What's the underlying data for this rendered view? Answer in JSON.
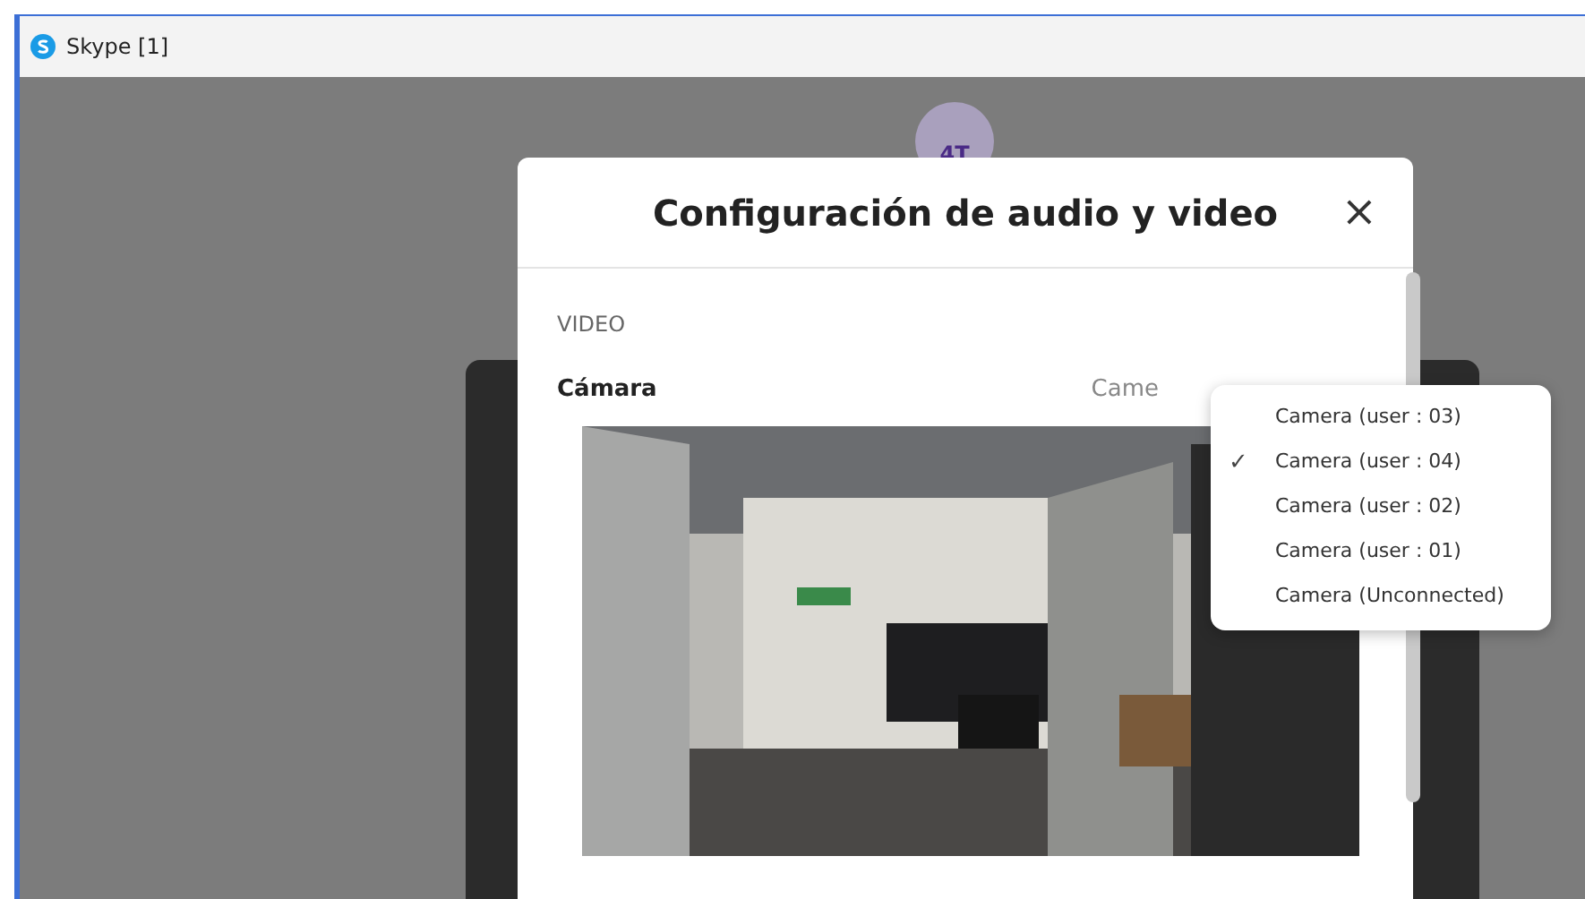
{
  "window": {
    "title": "Skype [1]"
  },
  "avatar": {
    "initials": "4T"
  },
  "dialog": {
    "title": "Configuración de audio y video",
    "close": "×",
    "section": "VIDEO",
    "camera_label": "Cámara",
    "camera_value": "Came"
  },
  "camera_menu": [
    {
      "label": "Camera (user : 03)",
      "selected": false
    },
    {
      "label": "Camera (user : 04)",
      "selected": true
    },
    {
      "label": "Camera (user : 02)",
      "selected": false
    },
    {
      "label": "Camera (user : 01)",
      "selected": false
    },
    {
      "label": "Camera (Unconnected)",
      "selected": false
    }
  ],
  "check_glyph": "✓"
}
